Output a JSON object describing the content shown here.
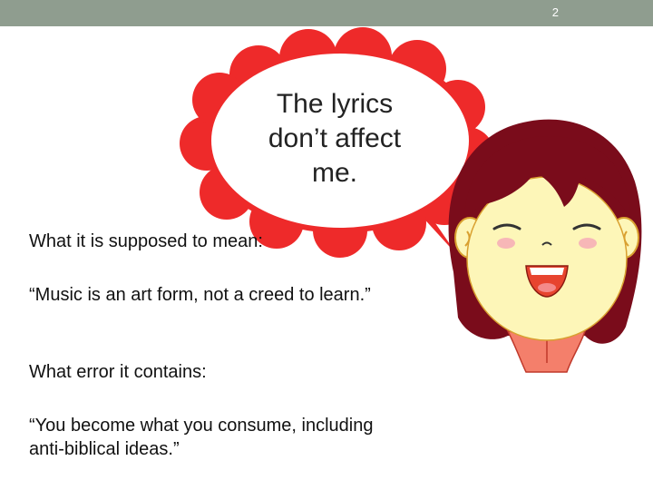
{
  "header": {
    "page_number": "2"
  },
  "speech_bubble": {
    "text": "The lyrics don’t affect me."
  },
  "content": {
    "heading_meaning": "What it is supposed to mean:",
    "quote_meaning": "“Music is an art form, not a creed to learn.”",
    "heading_error": "What error it contains:",
    "quote_error": "“You become what you consume, including anti-biblical ideas.”"
  },
  "colors": {
    "bar": "#8f9d8f",
    "bubble_red": "#ee2a2a",
    "hair": "#7a0c1b",
    "skin": "#fdf6b8",
    "collar": "#f47f6b"
  },
  "illustration": {
    "subject": "cartoon girl with speech bubble"
  }
}
